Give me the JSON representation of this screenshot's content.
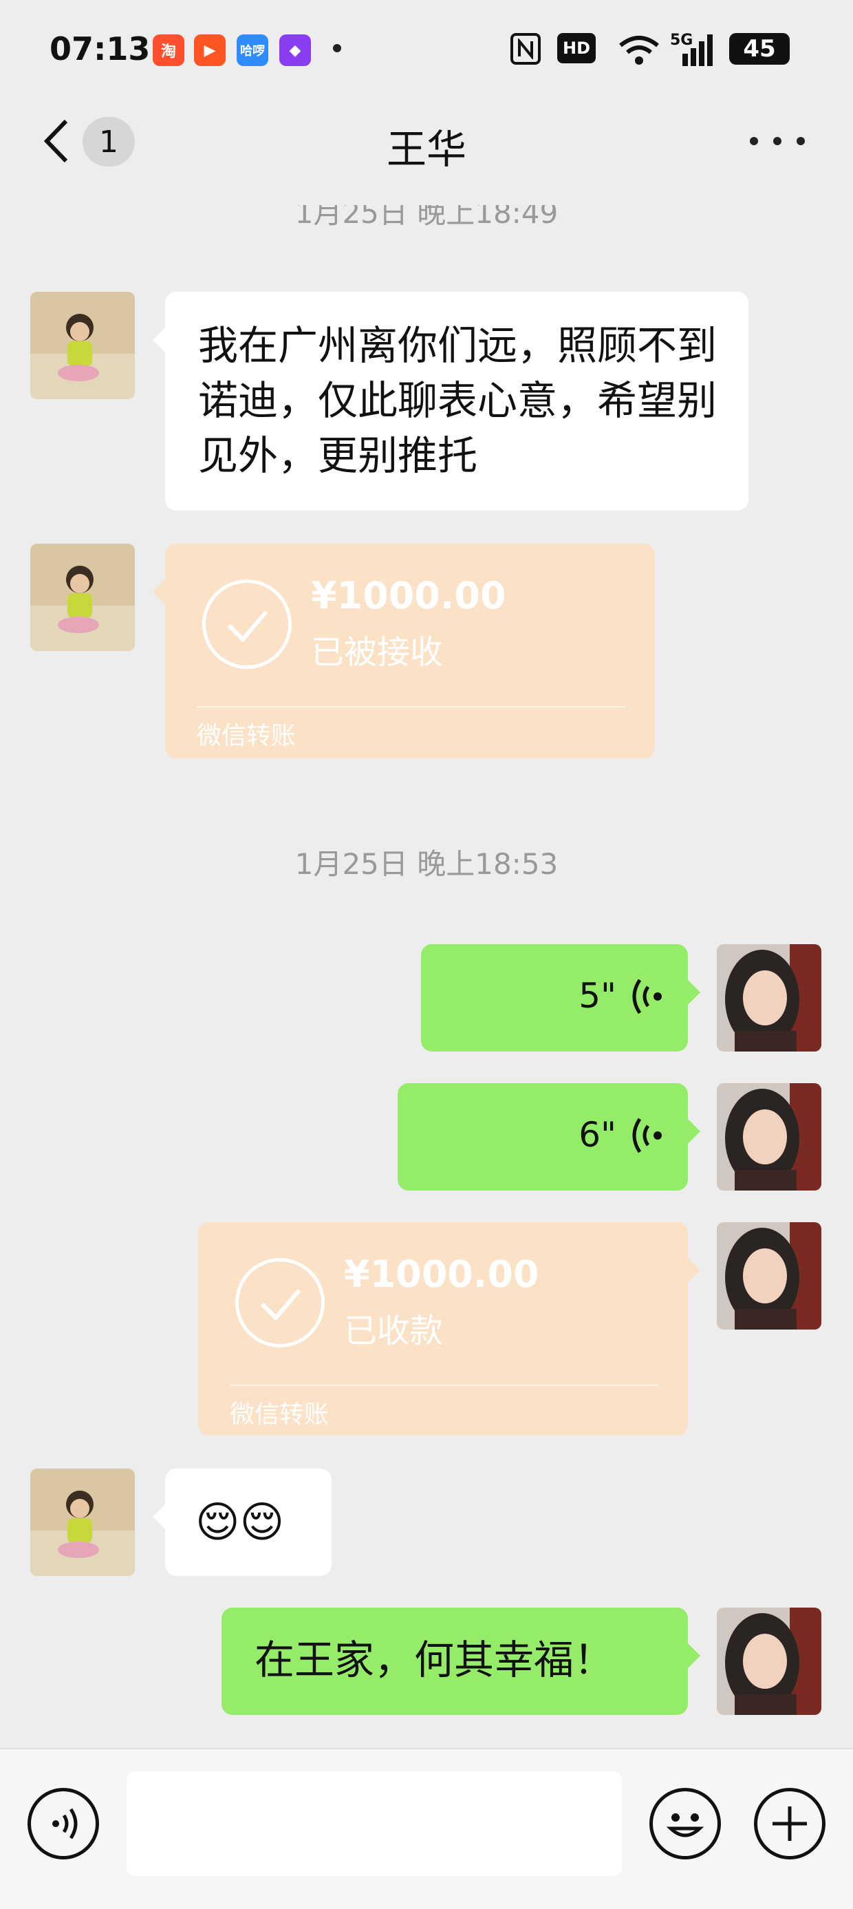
{
  "status_bar": {
    "time": "07:13",
    "apps": [
      {
        "icon": "taobao-icon",
        "text": "淘",
        "color": "#ff4f2e"
      },
      {
        "icon": "video-app-icon",
        "text": "▶",
        "color": "#ff5522"
      },
      {
        "icon": "haluo-icon",
        "text": "哈啰",
        "color": "#2f8cff"
      },
      {
        "icon": "game-app-icon",
        "text": "◆",
        "color": "#8a3cf0"
      }
    ],
    "hd_label": "HD",
    "signal_label": "5G",
    "battery": "45"
  },
  "header": {
    "unread_count": "1",
    "title": "王华"
  },
  "messages": {
    "timestamp_top": "1月25日 晚上18:49",
    "text_1": "我在广州离你们远，照顾不到诺迪，仅此聊表心意，希望别见外，更别推托",
    "transfer_1": {
      "amount": "¥1000.00",
      "status": "已被接收",
      "label": "微信转账"
    },
    "timestamp_2": "1月25日 晚上18:53",
    "voice_1": "5\"",
    "voice_2": "6\"",
    "transfer_2": {
      "amount": "¥1000.00",
      "status": "已收款",
      "label": "微信转账"
    },
    "emoji_message": "😌😌",
    "text_2": "在王家，何其幸福！"
  },
  "colors": {
    "background": "#ededed",
    "green_bubble": "#95ec69",
    "transfer_bubble": "#fbe1c5"
  }
}
